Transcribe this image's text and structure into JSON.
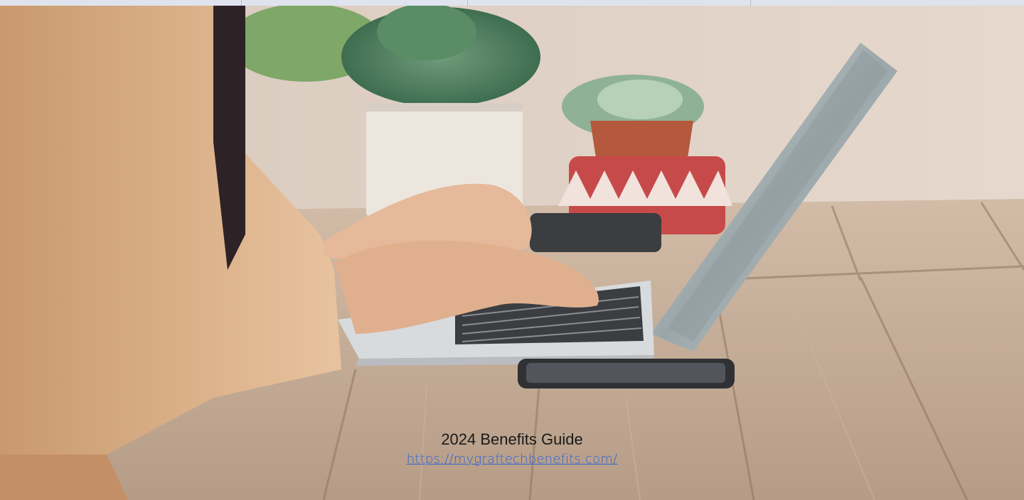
{
  "header": {
    "tabs": [
      "",
      "",
      "",
      ""
    ]
  },
  "hero": {
    "image_icon": "woman-typing-on-laptop-photo"
  },
  "caption": {
    "title": "2024 Benefits Guide",
    "link_text": "https://mygraftechbenefits.com/",
    "link_color": "#2e63d8"
  }
}
